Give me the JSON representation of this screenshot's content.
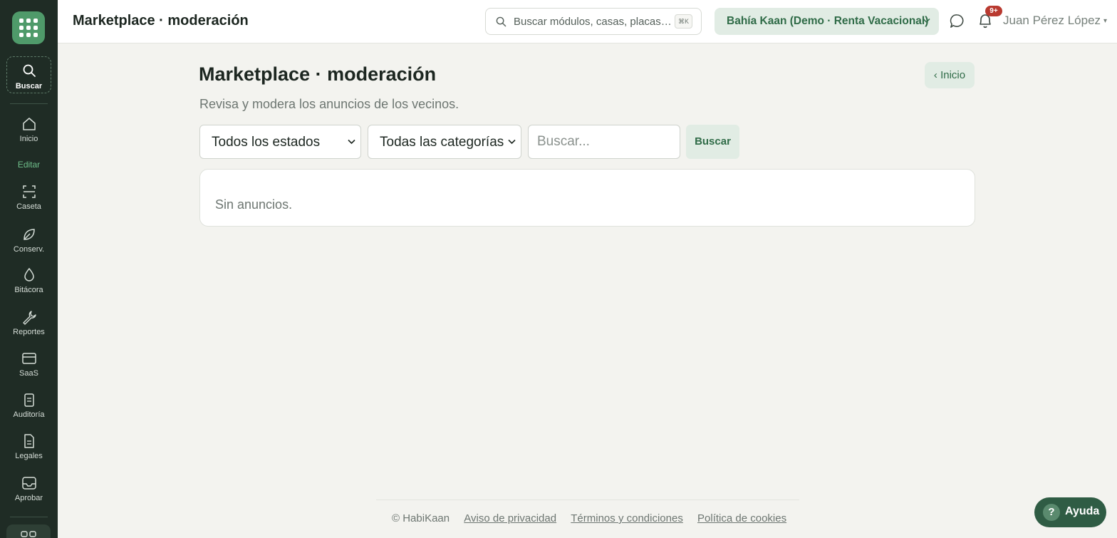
{
  "sidebar": {
    "search_label": "Buscar",
    "section_label": "Editar",
    "items": [
      {
        "label": "Inicio",
        "icon": "home-icon"
      },
      {
        "label": "Caseta",
        "icon": "scan-icon"
      },
      {
        "label": "Conserv.",
        "icon": "leaf-icon"
      },
      {
        "label": "Bitácora",
        "icon": "drop-icon"
      },
      {
        "label": "Reportes",
        "icon": "wrench-icon"
      },
      {
        "label": "SaaS",
        "icon": "card-icon"
      },
      {
        "label": "Auditoría",
        "icon": "clipboard-icon"
      },
      {
        "label": "Legales",
        "icon": "document-icon"
      },
      {
        "label": "Aprobar",
        "icon": "inbox-icon"
      }
    ]
  },
  "header": {
    "title": "Marketplace · moderación",
    "search_placeholder": "Buscar módulos, casas, placas…",
    "shortcut": "⌘K",
    "org": "Bahía Kaan (Demo · Renta Vacacional)",
    "notifications": "9+",
    "user": "Juan Pérez López"
  },
  "main": {
    "title": "Marketplace · moderación",
    "back_label": "‹ Inicio",
    "subtitle": "Revisa y modera los anuncios de los vecinos.",
    "filters": {
      "status": "Todos los estados",
      "category": "Todas las categorías",
      "search_placeholder": "Buscar...",
      "search_button": "Buscar"
    },
    "empty_message": "Sin anuncios."
  },
  "footer": {
    "copyright": "© HabiKaan",
    "links": [
      "Aviso de privacidad",
      "Términos y condiciones",
      "Política de cookies"
    ]
  },
  "help": {
    "label": "Ayuda",
    "icon": "?"
  },
  "colors": {
    "sidebar": "#1f2c25",
    "accent": "#2f6b47",
    "accent_bg": "#e1ece4",
    "badge": "#b93a30",
    "background": "#f3f3ef"
  }
}
